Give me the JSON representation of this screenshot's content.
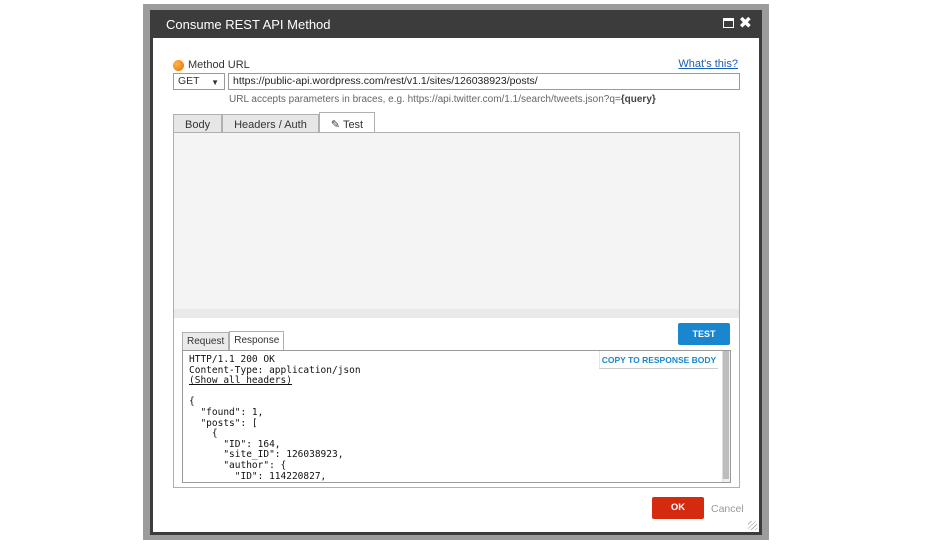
{
  "dialog": {
    "title": "Consume REST API Method",
    "maximize_icon": "maximize-icon",
    "close_glyph": "✖"
  },
  "method": {
    "label": "Method URL",
    "help_link": "What's this?",
    "selected": "GET",
    "url": "https://public-api.wordpress.com/rest/v1.1/sites/126038923/posts/",
    "hint_prefix": "URL accepts parameters in braces, e.g. https://api.twitter.com/1.1/search/tweets.json?q=",
    "hint_param": "{query}"
  },
  "tabs": [
    {
      "label": "Body",
      "active": false
    },
    {
      "label": "Headers / Auth",
      "active": false
    },
    {
      "label": "Test",
      "active": true,
      "icon": "edit-icon"
    }
  ],
  "test_panel": {
    "test_button": "TEST",
    "sub_tabs": [
      {
        "label": "Request",
        "active": false
      },
      {
        "label": "Response",
        "active": true
      }
    ],
    "copy_button": "COPY TO RESPONSE BODY",
    "response_status": "HTTP/1.1 200 OK",
    "response_content_type": "Content-Type: application/json",
    "show_headers_link": "(Show all headers)",
    "response_body": "{\n  \"found\": 1,\n  \"posts\": [\n    {\n      \"ID\": 164,\n      \"site_ID\": 126038923,\n      \"author\": {\n        \"ID\": 114220827,"
  },
  "footer": {
    "ok": "OK",
    "cancel": "Cancel"
  },
  "colors": {
    "titlebar": "#3c3c3c",
    "accent_blue": "#1a86cf",
    "ok_red": "#d42a10"
  }
}
